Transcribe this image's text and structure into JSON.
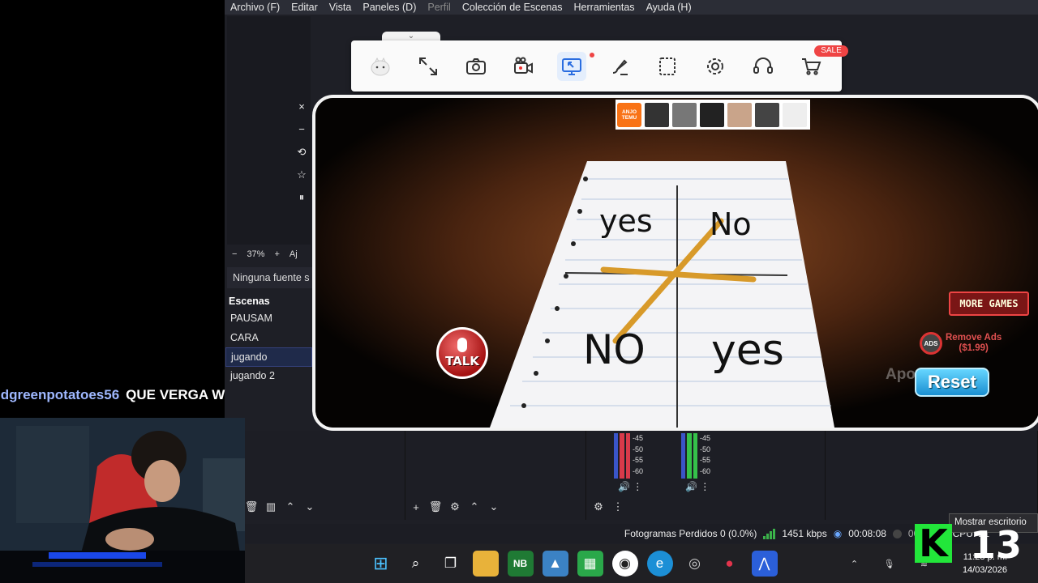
{
  "obs": {
    "menu": [
      {
        "label": "Archivo (F)",
        "dim": false
      },
      {
        "label": "Editar",
        "dim": false
      },
      {
        "label": "Vista",
        "dim": false
      },
      {
        "label": "Paneles (D)",
        "dim": false
      },
      {
        "label": "Perfil",
        "dim": true
      },
      {
        "label": "Colección de Escenas",
        "dim": false
      },
      {
        "label": "Herramientas",
        "dim": false
      },
      {
        "label": "Ayuda (H)",
        "dim": false
      }
    ],
    "zoom": {
      "minus": "−",
      "value": "37%",
      "plus": "+",
      "fit": "Aj"
    },
    "sources_empty": "Ninguna fuente s",
    "scenes": {
      "title": "Escenas",
      "items": [
        "PAUSAM",
        "CARA",
        "jugando",
        "jugando 2"
      ],
      "active_index": 2
    },
    "mixer": {
      "levels": [
        "-45",
        "-50",
        "-55",
        "-60"
      ]
    },
    "status": {
      "dropped": "Fotogramas Perdidos 0 (0.0%)",
      "bitrate": "1451 kbps",
      "rec_time": "00:08:08",
      "stream_time": "00:00:00",
      "cpu": "CPU: 21"
    }
  },
  "chat": {
    "user": "ldgreenpotatoes56",
    "message": "QUE VERGA W"
  },
  "mirror": {
    "tab_icon": "chevron-down-icon",
    "sale": "SALE",
    "tools": [
      "logo-icon",
      "fullscreen-icon",
      "screenshot-icon",
      "record-icon",
      "mirror-cast-icon",
      "brush-icon",
      "crop-icon",
      "settings-icon",
      "support-icon",
      "cart-icon"
    ],
    "side": [
      "×",
      "−",
      "⟲",
      "☆",
      "⏸"
    ],
    "watermark": "ApowerMirror"
  },
  "game": {
    "labels": {
      "top_left": "yes",
      "top_right": "No",
      "bottom_left": "NO",
      "bottom_right": "yes"
    },
    "talk": "TALK",
    "more_games": "MORE GAMES",
    "remove_ads_line1": "Remove Ads",
    "remove_ads_line2": "($1.99)",
    "no_ads_icon": "ADS",
    "reset": "Reset",
    "ad": {
      "brand": "ANJO TEMU"
    }
  },
  "taskbar": {
    "show_desktop": "Mostrar escritorio",
    "time": "11:28 p. m.",
    "date": "14/03/2026"
  },
  "overlay": {
    "k_letter": "K",
    "k_number": "13"
  },
  "colors": {
    "obs_bg": "#1e1f26",
    "accent_green": "#22e63a",
    "meter_red": "#d83a4a",
    "meter_green": "#35c24a"
  }
}
